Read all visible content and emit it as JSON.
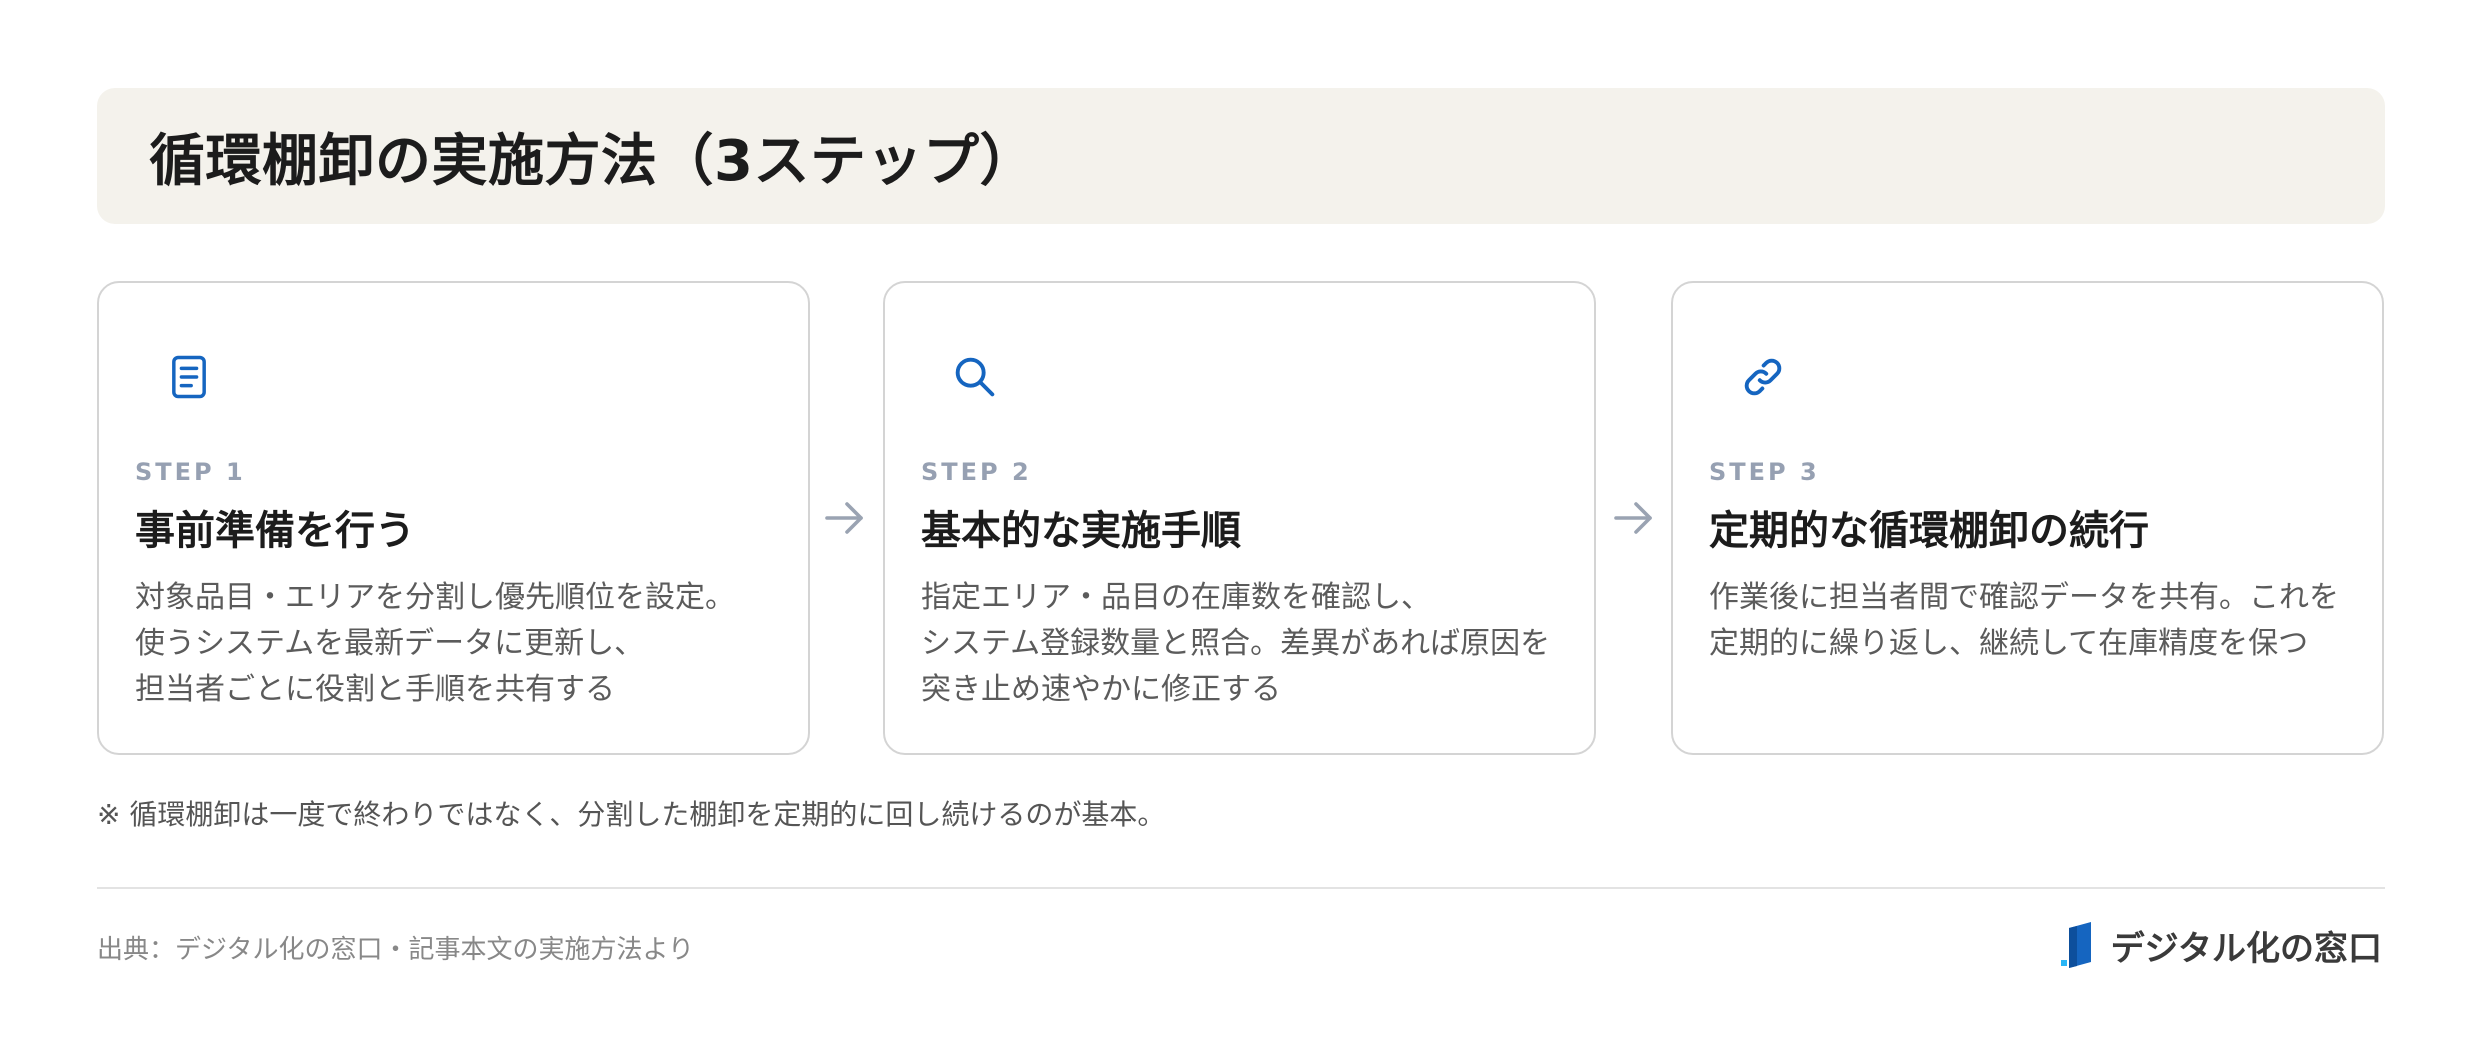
{
  "title": "循環棚卸の実施方法（3ステップ）",
  "steps": [
    {
      "icon": "document-icon",
      "step": "STEP 1",
      "heading": "事前準備を行う",
      "desc": "対象品目・エリアを分割し優先順位を設定。\n使うシステムを最新データに更新し、\n担当者ごとに役割と手順を共有する"
    },
    {
      "icon": "search-icon",
      "step": "STEP 2",
      "heading": "基本的な実施手順",
      "desc": "指定エリア・品目の在庫数を確認し、\nシステム登録数量と照合。差異があれば原因を\n突き止め速やかに修正する"
    },
    {
      "icon": "link-icon",
      "step": "STEP 3",
      "heading": "定期的な循環棚卸の続行",
      "desc": "作業後に担当者間で確認データを共有。これを\n定期的に繰り返し、継続して在庫精度を保つ"
    }
  ],
  "note": "※ 循環棚卸は一度で終わりではなく、分割した棚卸を定期的に回し続けるのが基本。",
  "source": "出典：デジタル化の窓口・記事本文の実施方法より",
  "brand": "デジタル化の窓口",
  "colors": {
    "accent": "#1565c0",
    "title_bg": "#f4f2ec",
    "step_label": "#96a0b2"
  }
}
